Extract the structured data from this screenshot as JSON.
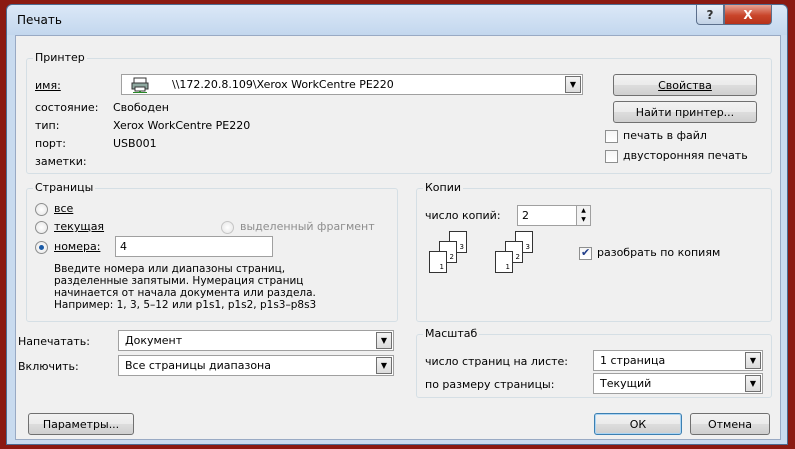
{
  "window": {
    "title": "Печать",
    "help_glyph": "?",
    "close_glyph": "X"
  },
  "printer_group": {
    "title": "Принтер",
    "name_label": "имя:",
    "name_value": "\\\\172.20.8.109\\Xerox WorkCentre PE220",
    "status_label": "состояние:",
    "status_value": "Свободен",
    "type_label": "тип:",
    "type_value": "Xerox WorkCentre PE220",
    "port_label": "порт:",
    "port_value": "USB001",
    "notes_label": "заметки:",
    "properties_button": "Свойства",
    "find_printer_button": "Найти принтер...",
    "print_to_file_label": "печать в файл",
    "print_to_file_checked": false,
    "duplex_label": "двусторонняя печать",
    "duplex_checked": false
  },
  "pages_group": {
    "title": "Страницы",
    "all_label": "все",
    "current_label": "текущая",
    "selection_label": "выделенный фрагмент",
    "numbers_label": "номера:",
    "numbers_value": "4",
    "selected_option": "номера",
    "help_line1": "Введите номера или диапазоны страниц,",
    "help_line2": "разделенные запятыми. Нумерация страниц",
    "help_line3": "начинается от начала документа или раздела.",
    "help_line4": "Например: 1, 3, 5–12 или p1s1, p1s2, p1s3–p8s3"
  },
  "copies_group": {
    "title": "Копии",
    "count_label": "число копий:",
    "count_value": "2",
    "collate_label": "разобрать по копиям",
    "collate_checked": true,
    "page_numbers": [
      "1",
      "2",
      "3"
    ]
  },
  "print_what": {
    "label": "Напечатать:",
    "value": "Документ"
  },
  "include": {
    "label": "Включить:",
    "value": "Все страницы диапазона"
  },
  "scale_group": {
    "title": "Масштаб",
    "pages_per_sheet_label": "число страниц на листе:",
    "pages_per_sheet_value": "1 страница",
    "scale_to_paper_label": "по размеру страницы:",
    "scale_to_paper_value": "Текущий"
  },
  "footer": {
    "options_button": "Параметры...",
    "ok_button": "ОК",
    "cancel_button": "Отмена"
  },
  "icons": {
    "printer": "network-printer-icon",
    "dropdown": "chevron-down-icon",
    "spin": "spin-arrows-icon"
  }
}
